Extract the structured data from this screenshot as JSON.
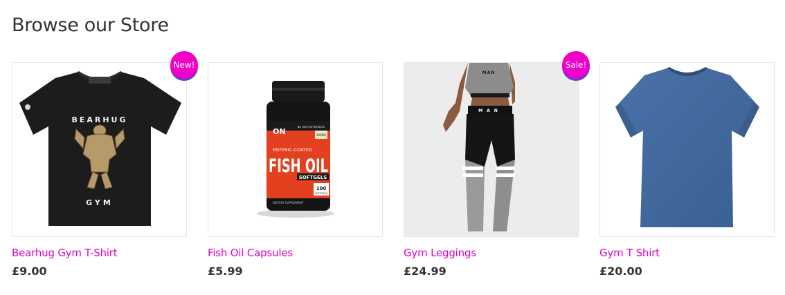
{
  "store": {
    "heading": "Browse our Store",
    "colors": {
      "accent": "#e000c8",
      "badge": "#f000c8",
      "text": "#333333"
    },
    "products": [
      {
        "title": "Bearhug Gym T-Shirt",
        "price": "£9.00",
        "badge": "New!",
        "image": "black-tshirt-image",
        "print": {
          "top": "BEARHUG",
          "bottom": "GYM"
        }
      },
      {
        "title": "Fish Oil Capsules",
        "price": "£5.99",
        "badge": "",
        "image": "supplement-bottle-image",
        "label": {
          "brand": "ON",
          "enteric": "ENTERIC-COATED",
          "product": "FISH OIL",
          "form": "SOFTGELS",
          "count": "100",
          "count_unit": "SOFTGELS",
          "dose": "300MG",
          "note": "NO FISHY AFTERTASTE",
          "footer": "DIETARY SUPPLEMENT"
        }
      },
      {
        "title": "Gym Leggings",
        "price": "£24.99",
        "badge": "Sale!",
        "image": "gym-leggings-image",
        "band_text": "MAN"
      },
      {
        "title": "Gym T Shirt",
        "price": "£20.00",
        "badge": "",
        "image": "blue-tshirt-image"
      }
    ]
  }
}
